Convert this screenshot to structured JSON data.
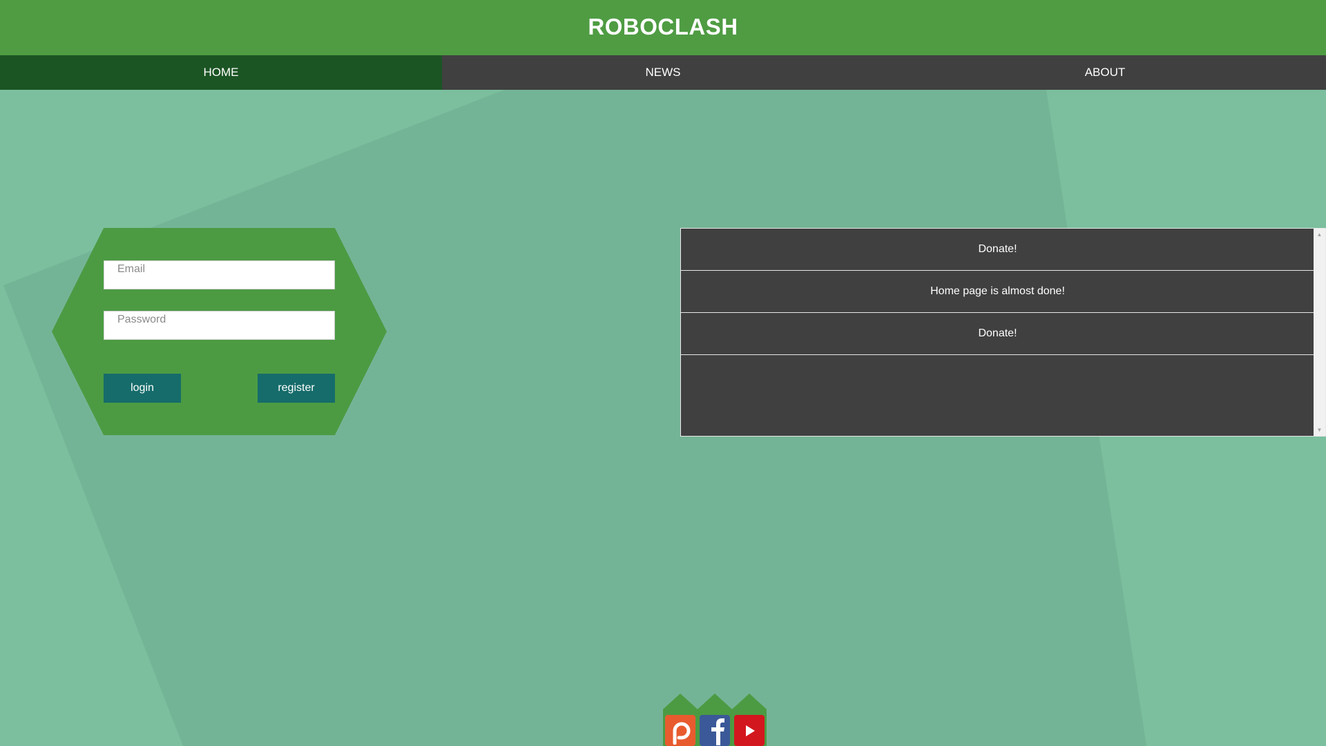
{
  "header": {
    "title": "ROBOCLASH"
  },
  "nav": {
    "items": [
      {
        "label": "HOME",
        "active": true
      },
      {
        "label": "NEWS",
        "active": false
      },
      {
        "label": "ABOUT",
        "active": false
      }
    ]
  },
  "login": {
    "email_placeholder": "Email",
    "password_placeholder": "Password",
    "login_label": "login",
    "register_label": "register"
  },
  "news": {
    "items": [
      "Donate!",
      "Home page is almost done!",
      "Donate!"
    ]
  },
  "social": {
    "links": [
      {
        "icon": "patreon-icon",
        "color": "#e85b2f"
      },
      {
        "icon": "facebook-icon",
        "color": "#3b5998"
      },
      {
        "icon": "youtube-icon",
        "color": "#d3171e"
      }
    ]
  },
  "colors": {
    "header_green": "#4f9c43",
    "nav_dark": "#404040",
    "nav_active": "#1c5524",
    "background": "#7bbf9e",
    "button_teal": "#156c6a"
  }
}
